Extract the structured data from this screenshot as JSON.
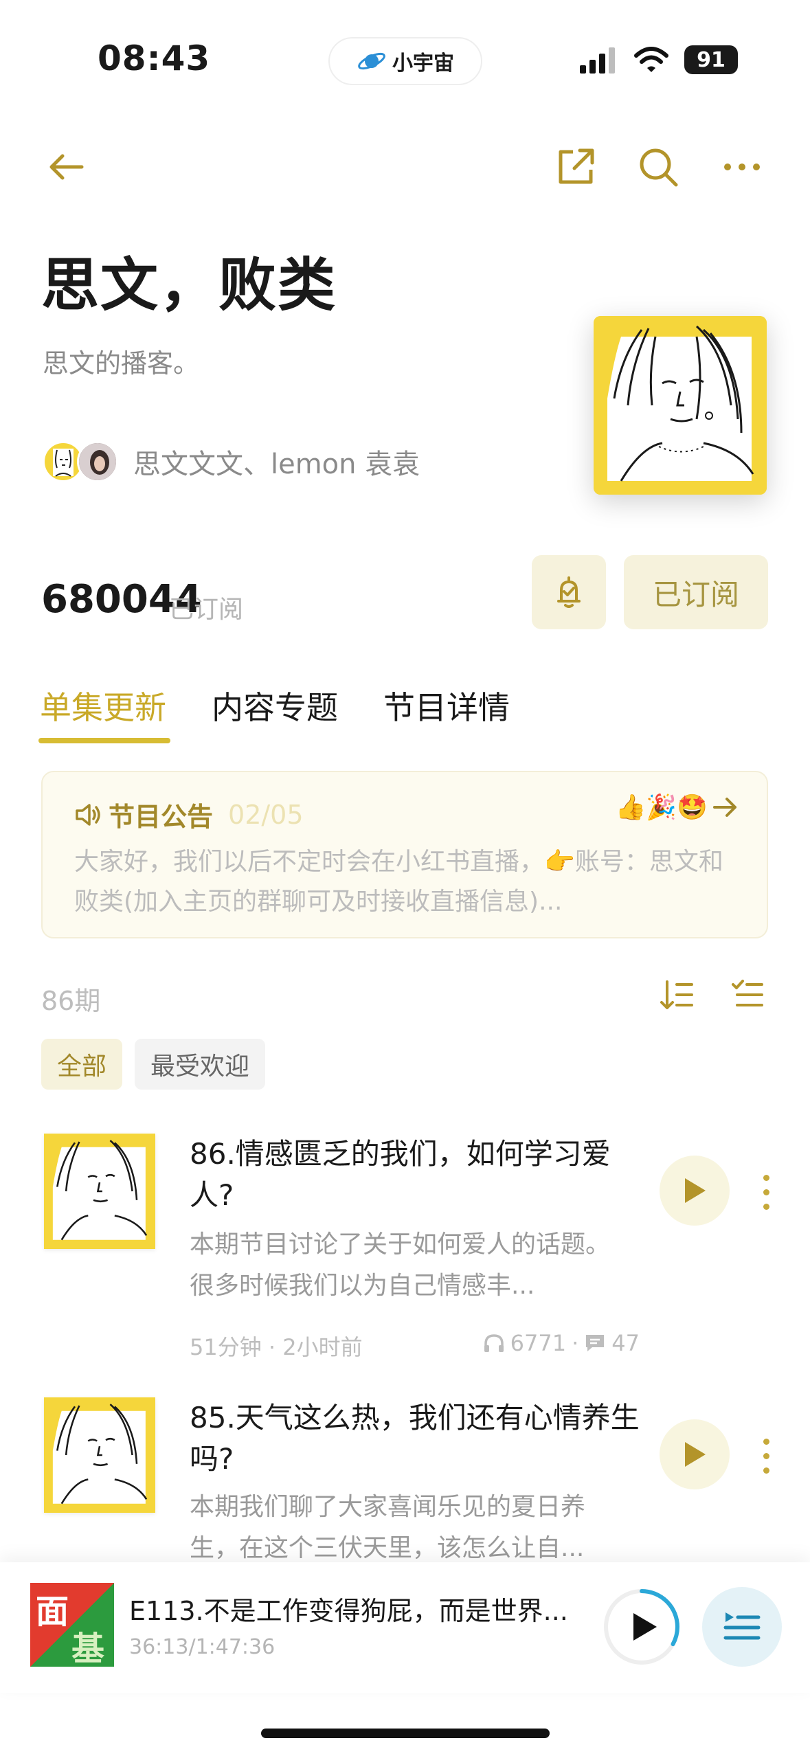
{
  "status_bar": {
    "time": "08:43",
    "app_pill": "小宇宙",
    "battery": "91"
  },
  "podcast": {
    "title": "思文，败类",
    "description": "思文的播客。",
    "hosts": "思文文文、lemon 袁袁",
    "subscriber_count": "680044",
    "subscriber_label": "已订阅",
    "subscribed_button": "已订阅"
  },
  "tabs": [
    {
      "label": "单集更新",
      "active": true
    },
    {
      "label": "内容专题",
      "active": false
    },
    {
      "label": "节目详情",
      "active": false
    }
  ],
  "notice": {
    "title": "节目公告",
    "date": "02/05",
    "emojis": "👍🎉🤩",
    "body": "大家好，我们以后不定时会在小红书直播，👉账号：思文和败类(加入主页的群聊可及时接收直播信息)..."
  },
  "episode_list": {
    "count": "86期",
    "filters": [
      "全部",
      "最受欢迎"
    ],
    "episodes": [
      {
        "title": "86.情感匮乏的我们，如何学习爱人?",
        "desc": "本期节目讨论了关于如何爱人的话题。很多时候我们以为自己情感丰...",
        "meta": "51分钟 · 2小时前",
        "plays": "6771",
        "comments": "47"
      },
      {
        "title": "85.天气这么热，我们还有心情养生吗?",
        "desc": "本期我们聊了大家喜闻乐见的夏日养生，在这个三伏天里，该怎么让自...",
        "meta": "",
        "plays": "",
        "comments": ""
      }
    ]
  },
  "player": {
    "title": "E113.不是工作变得狗屁，而是世界...",
    "time": "36:13/1:47:36",
    "thumb_text_top": "面",
    "thumb_text_bottom": "基",
    "progress": 0.33
  },
  "colors": {
    "accent": "#C9A928",
    "accent_bg": "#F6F2DC",
    "player_accent": "#2BA8D8"
  }
}
